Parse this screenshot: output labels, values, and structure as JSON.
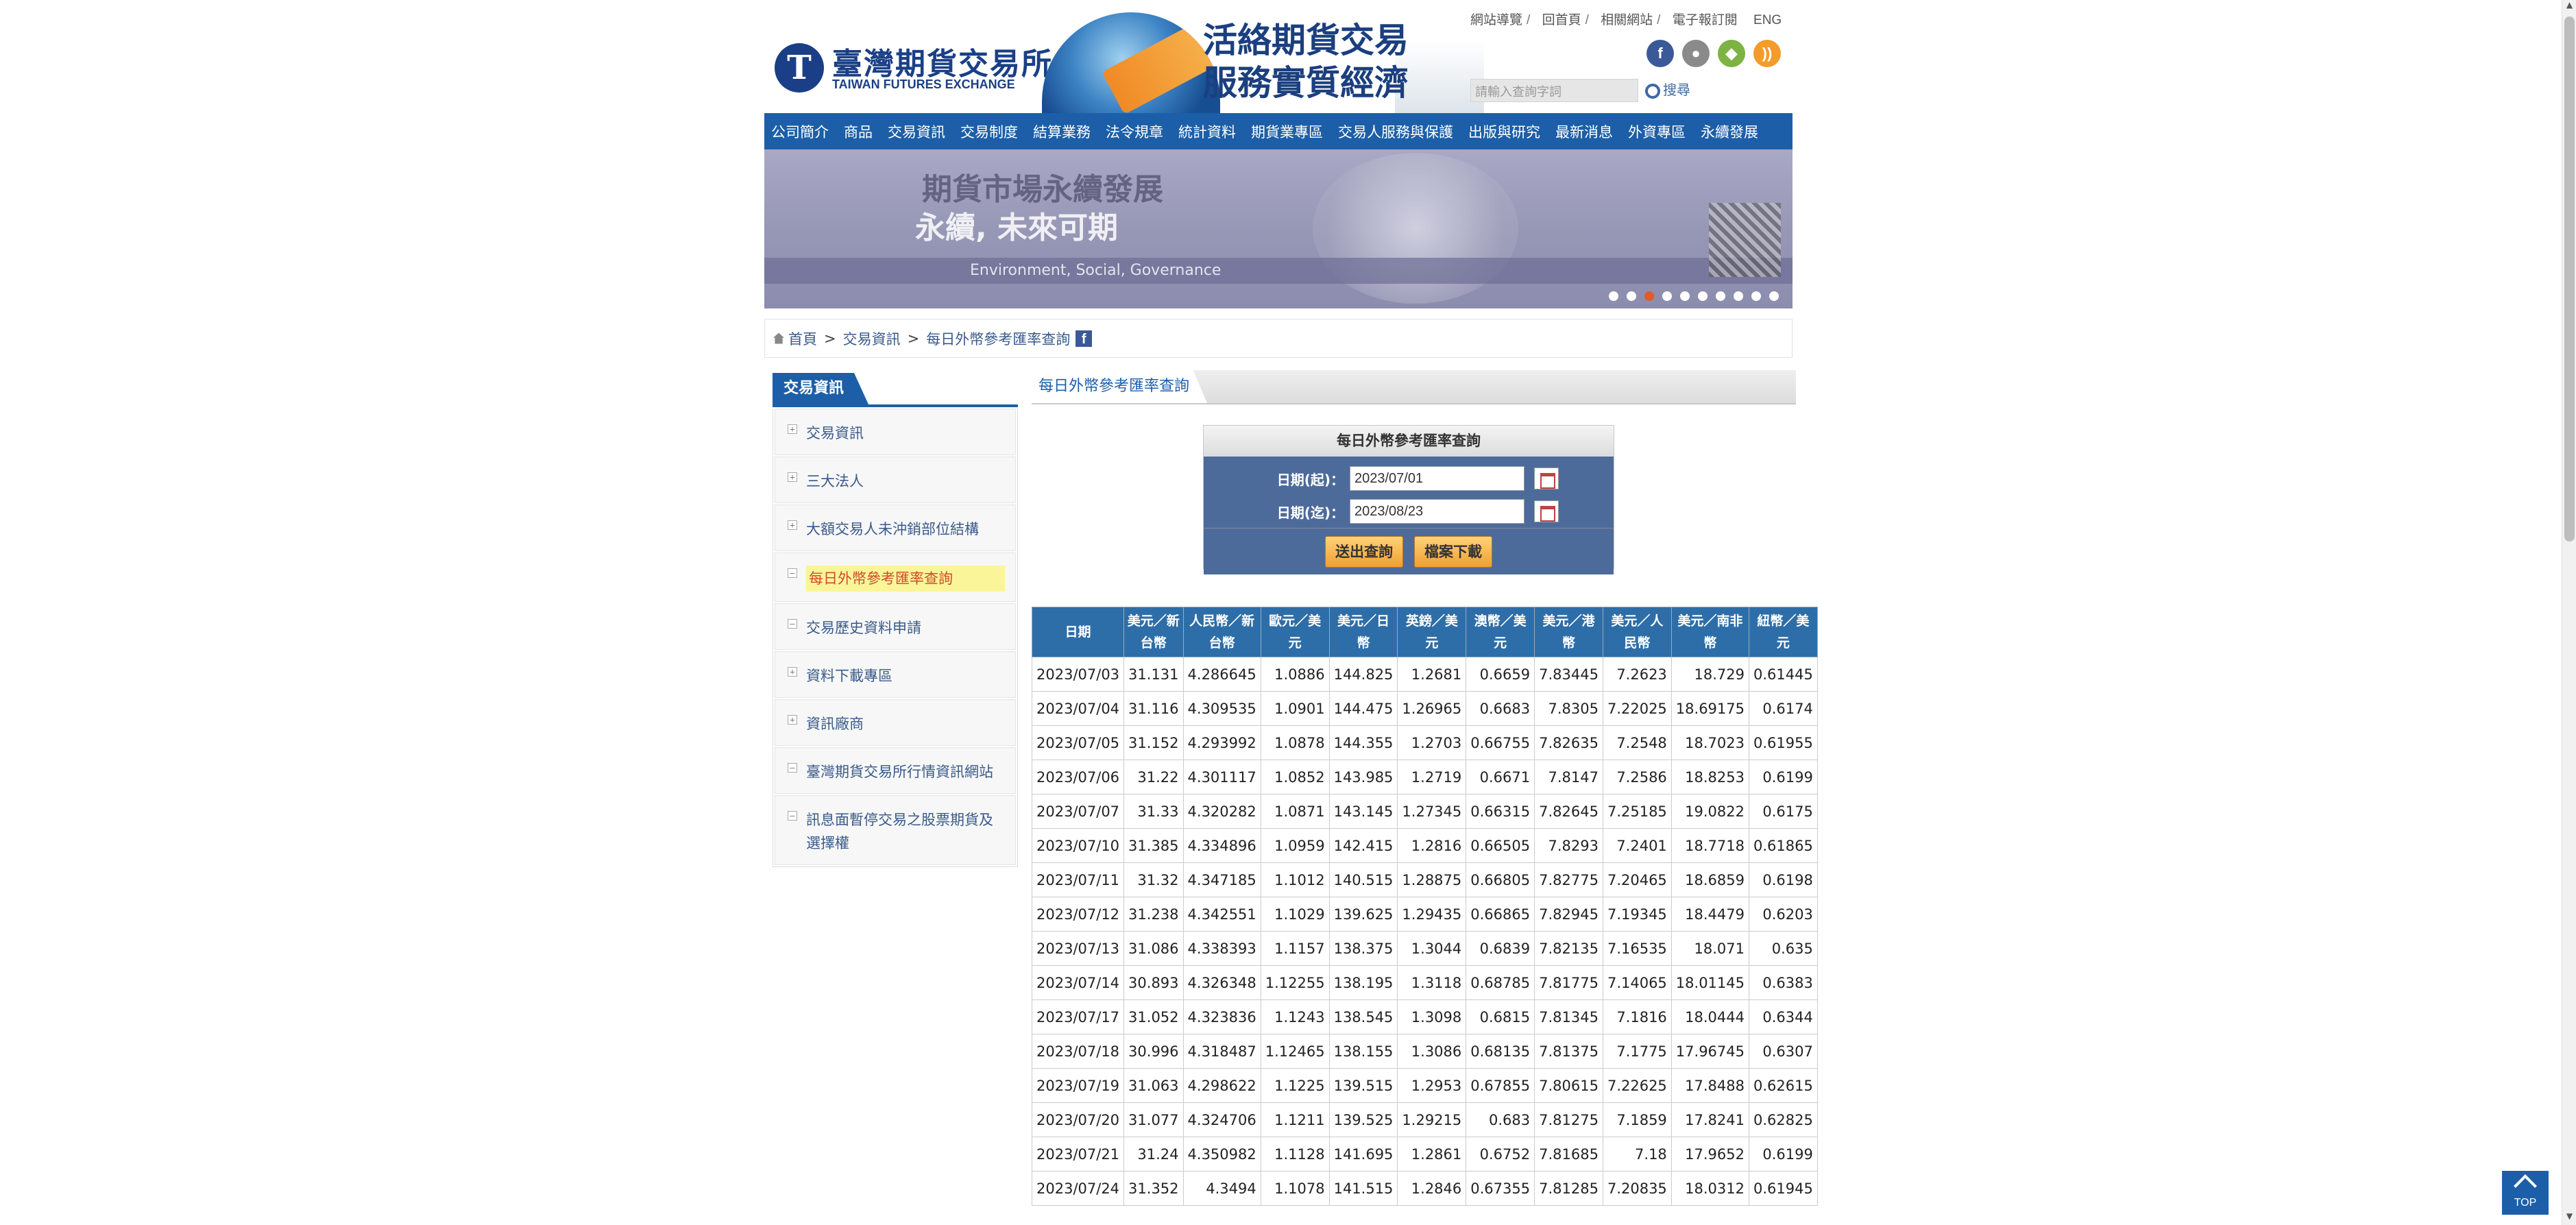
{
  "header": {
    "logo_cn": "臺灣期貨交易所",
    "logo_en": "TAIWAN FUTURES EXCHANGE",
    "slogan_line1": "活絡期貨交易",
    "slogan_line2": "服務實質經濟",
    "top_links": [
      "網站導覽",
      "回首頁",
      "相關網站",
      "電子報訂閱",
      "ENG"
    ],
    "search_placeholder": "請輸入查詢字詞",
    "search_button": "搜尋",
    "social": [
      {
        "icon": "facebook-icon",
        "color": "#3b5998",
        "glyph": "f"
      },
      {
        "icon": "apple-icon",
        "color": "#8a8a8a",
        "glyph": ""
      },
      {
        "icon": "android-icon",
        "color": "#7cb342",
        "glyph": "a"
      },
      {
        "icon": "rss-icon",
        "color": "#f39c2a",
        "glyph": "r"
      }
    ]
  },
  "nav": [
    "公司簡介",
    "商品",
    "交易資訊",
    "交易制度",
    "結算業務",
    "法令規章",
    "統計資料",
    "期貨業專區",
    "交易人服務與保護",
    "出版與研究",
    "最新消息",
    "外資專區",
    "永續發展"
  ],
  "banner": {
    "line1": "期貨市場永續發展",
    "line2": "永續, 未來可期",
    "line3": "Environment, Social, Governance",
    "dots": 10,
    "active_dot": 3
  },
  "breadcrumb": [
    "首頁",
    "交易資訊",
    "每日外幣參考匯率查詢"
  ],
  "sidebar": {
    "title": "交易資訊",
    "items": [
      {
        "label": "交易資訊",
        "expandable": true,
        "active": false
      },
      {
        "label": "三大法人",
        "expandable": true,
        "active": false
      },
      {
        "label": "大額交易人未沖銷部位結構",
        "expandable": true,
        "active": false
      },
      {
        "label": "每日外幣參考匯率查詢",
        "expandable": false,
        "active": true
      },
      {
        "label": "交易歷史資料申請",
        "expandable": false,
        "active": false
      },
      {
        "label": "資料下載專區",
        "expandable": true,
        "active": false
      },
      {
        "label": "資訊廠商",
        "expandable": true,
        "active": false
      },
      {
        "label": "臺灣期貨交易所行情資訊網站",
        "expandable": false,
        "active": false
      },
      {
        "label": "訊息面暫停交易之股票期貨及選擇權",
        "expandable": false,
        "active": false
      }
    ]
  },
  "main": {
    "title": "每日外幣參考匯率查詢",
    "form": {
      "title": "每日外幣參考匯率查詢",
      "start_label": "日期(起)：",
      "start_value": "2023/07/01",
      "end_label": "日期(迄)：",
      "end_value": "2023/08/23",
      "submit": "送出查詢",
      "download": "檔案下載"
    },
    "table": {
      "headers": [
        "日期",
        "美元／新台幣",
        "人民幣／新台幣",
        "歐元／美元",
        "美元／日幣",
        "英鎊／美元",
        "澳幣／美元",
        "美元／港幣",
        "美元／人民幣",
        "美元／南非幣",
        "紐幣／美元"
      ],
      "rows": [
        [
          "2023/07/03",
          "31.131",
          "4.286645",
          "1.0886",
          "144.825",
          "1.2681",
          "0.6659",
          "7.83445",
          "7.2623",
          "18.729",
          "0.61445"
        ],
        [
          "2023/07/04",
          "31.116",
          "4.309535",
          "1.0901",
          "144.475",
          "1.26965",
          "0.6683",
          "7.8305",
          "7.22025",
          "18.69175",
          "0.6174"
        ],
        [
          "2023/07/05",
          "31.152",
          "4.293992",
          "1.0878",
          "144.355",
          "1.2703",
          "0.66755",
          "7.82635",
          "7.2548",
          "18.7023",
          "0.61955"
        ],
        [
          "2023/07/06",
          "31.22",
          "4.301117",
          "1.0852",
          "143.985",
          "1.2719",
          "0.6671",
          "7.8147",
          "7.2586",
          "18.8253",
          "0.6199"
        ],
        [
          "2023/07/07",
          "31.33",
          "4.320282",
          "1.0871",
          "143.145",
          "1.27345",
          "0.66315",
          "7.82645",
          "7.25185",
          "19.0822",
          "0.6175"
        ],
        [
          "2023/07/10",
          "31.385",
          "4.334896",
          "1.0959",
          "142.415",
          "1.2816",
          "0.66505",
          "7.8293",
          "7.2401",
          "18.7718",
          "0.61865"
        ],
        [
          "2023/07/11",
          "31.32",
          "4.347185",
          "1.1012",
          "140.515",
          "1.28875",
          "0.66805",
          "7.82775",
          "7.20465",
          "18.6859",
          "0.6198"
        ],
        [
          "2023/07/12",
          "31.238",
          "4.342551",
          "1.1029",
          "139.625",
          "1.29435",
          "0.66865",
          "7.82945",
          "7.19345",
          "18.4479",
          "0.6203"
        ],
        [
          "2023/07/13",
          "31.086",
          "4.338393",
          "1.1157",
          "138.375",
          "1.3044",
          "0.6839",
          "7.82135",
          "7.16535",
          "18.071",
          "0.635"
        ],
        [
          "2023/07/14",
          "30.893",
          "4.326348",
          "1.12255",
          "138.195",
          "1.3118",
          "0.68785",
          "7.81775",
          "7.14065",
          "18.01145",
          "0.6383"
        ],
        [
          "2023/07/17",
          "31.052",
          "4.323836",
          "1.1243",
          "138.545",
          "1.3098",
          "0.6815",
          "7.81345",
          "7.1816",
          "18.0444",
          "0.6344"
        ],
        [
          "2023/07/18",
          "30.996",
          "4.318487",
          "1.12465",
          "138.155",
          "1.3086",
          "0.68135",
          "7.81375",
          "7.1775",
          "17.96745",
          "0.6307"
        ],
        [
          "2023/07/19",
          "31.063",
          "4.298622",
          "1.1225",
          "139.515",
          "1.2953",
          "0.67855",
          "7.80615",
          "7.22625",
          "17.8488",
          "0.62615"
        ],
        [
          "2023/07/20",
          "31.077",
          "4.324706",
          "1.1211",
          "139.525",
          "1.29215",
          "0.683",
          "7.81275",
          "7.1859",
          "17.8241",
          "0.62825"
        ],
        [
          "2023/07/21",
          "31.24",
          "4.350982",
          "1.1128",
          "141.695",
          "1.2861",
          "0.6752",
          "7.81685",
          "7.18",
          "17.9652",
          "0.6199"
        ],
        [
          "2023/07/24",
          "31.352",
          "4.3494",
          "1.1078",
          "141.515",
          "1.2846",
          "0.67355",
          "7.81285",
          "7.20835",
          "18.0312",
          "0.61945"
        ]
      ]
    }
  },
  "top_button": "TOP"
}
